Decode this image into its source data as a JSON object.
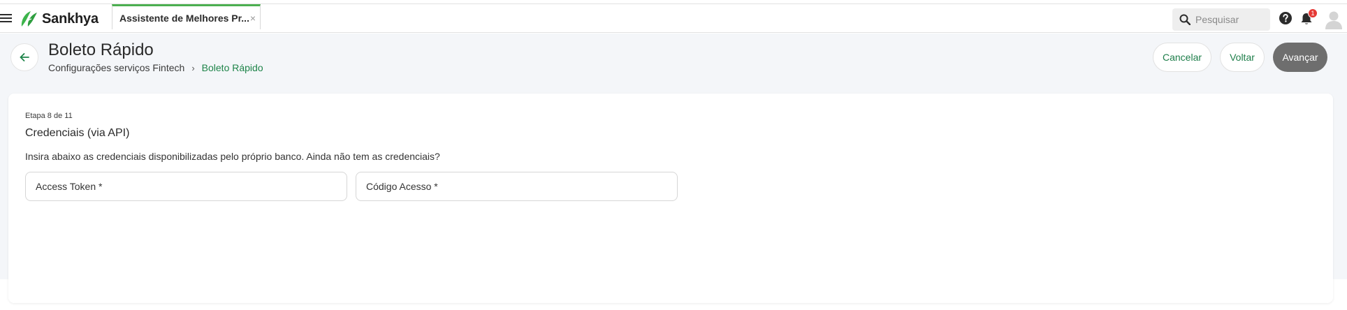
{
  "app": {
    "brand": "Sankhya",
    "tab_title": "Assistente de Melhores Pr...",
    "tab_close": "×"
  },
  "header": {
    "search_placeholder": "Pesquisar",
    "notification_count": "1"
  },
  "page": {
    "title": "Boleto Rápido",
    "breadcrumb": [
      "Configurações serviços Fintech",
      "Boleto Rápido"
    ]
  },
  "actions": {
    "cancel": "Cancelar",
    "back": "Voltar",
    "next": "Avançar"
  },
  "wizard": {
    "step": "Etapa 8 de 11",
    "title": "Credenciais (via API)",
    "description": "Insira abaixo as credenciais disponibilizadas pelo próprio banco. Ainda não tem as credenciais?",
    "fields": [
      {
        "placeholder": "Access Token *",
        "value": ""
      },
      {
        "placeholder": "Código Acesso *",
        "value": ""
      }
    ]
  },
  "colors": {
    "accent_green": "#1e8449",
    "tab_indicator": "#4caf50",
    "primary_button": "#6e6e6e",
    "badge": "#e53935"
  },
  "icons": [
    "hamburger-icon",
    "sankhya-logo-icon",
    "close-icon",
    "search-icon",
    "help-icon",
    "bell-icon",
    "avatar-icon",
    "arrow-left-icon",
    "chevron-right-icon"
  ]
}
